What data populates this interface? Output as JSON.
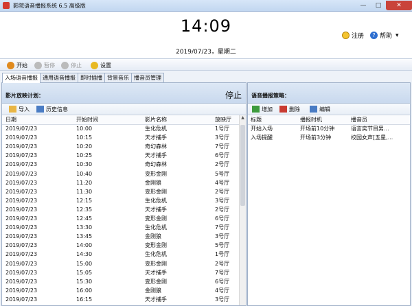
{
  "window": {
    "title": "影院语音播报系统 6.5 高级版",
    "buttons": {
      "minimize": "—",
      "maximize": "□",
      "close": "✕"
    }
  },
  "header": {
    "time": "14:09",
    "date": "2019/07/23，星期二",
    "register": "注册",
    "help": "帮助",
    "menu_arrow": "▾"
  },
  "toolbar": {
    "start": "开始",
    "pause": "暂停",
    "stop": "停止",
    "settings": "设置"
  },
  "tabs": [
    "入场语音播报",
    "通用语音播报",
    "即时插播",
    "背景音乐",
    "播音员管理"
  ],
  "left_panel": {
    "title": "影片放映计划：",
    "status": "停止",
    "import": "导入",
    "history": "历史信息",
    "columns": [
      "日期",
      "开始时间",
      "影片名称",
      "放映厅"
    ],
    "rows": [
      [
        "2019/07/23",
        "10:00",
        "生化危机",
        "1号厅"
      ],
      [
        "2019/07/23",
        "10:15",
        "天才捕手",
        "3号厅"
      ],
      [
        "2019/07/23",
        "10:20",
        "奇幻森林",
        "7号厅"
      ],
      [
        "2019/07/23",
        "10:25",
        "天才捕手",
        "6号厅"
      ],
      [
        "2019/07/23",
        "10:30",
        "奇幻森林",
        "2号厅"
      ],
      [
        "2019/07/23",
        "10:40",
        "变形金刚",
        "5号厅"
      ],
      [
        "2019/07/23",
        "11:20",
        "金刚狼",
        "4号厅"
      ],
      [
        "2019/07/23",
        "11:30",
        "变形金刚",
        "2号厅"
      ],
      [
        "2019/07/23",
        "12:15",
        "生化危机",
        "3号厅"
      ],
      [
        "2019/07/23",
        "12:35",
        "天才捕手",
        "2号厅"
      ],
      [
        "2019/07/23",
        "12:45",
        "变形金刚",
        "6号厅"
      ],
      [
        "2019/07/23",
        "13:30",
        "生化危机",
        "7号厅"
      ],
      [
        "2019/07/23",
        "13:45",
        "金刚狼",
        "3号厅"
      ],
      [
        "2019/07/23",
        "14:00",
        "变形金刚",
        "5号厅"
      ],
      [
        "2019/07/23",
        "14:30",
        "生化危机",
        "1号厅"
      ],
      [
        "2019/07/23",
        "15:00",
        "变形金刚",
        "2号厅"
      ],
      [
        "2019/07/23",
        "15:05",
        "天才捕手",
        "7号厅"
      ],
      [
        "2019/07/23",
        "15:30",
        "变形金刚",
        "6号厅"
      ],
      [
        "2019/07/23",
        "16:00",
        "金刚狼",
        "4号厅"
      ],
      [
        "2019/07/23",
        "16:15",
        "天才捕手",
        "3号厅"
      ]
    ]
  },
  "right_panel": {
    "title": "语音播报策略：",
    "add": "增加",
    "delete": "删除",
    "edit": "编辑",
    "columns": [
      "标题",
      "播报时机",
      "播音员"
    ],
    "rows": [
      [
        "开始入场",
        "开场前10分钟",
        "语言奕节目男..."
      ],
      [
        "入场提醒",
        "开场前3分钟",
        "校园女声[五星,..."
      ]
    ]
  },
  "colors": {
    "close_button": "#c9433a",
    "panel_header": "#c9d9ee",
    "accent_blue": "#2e6fd0"
  }
}
